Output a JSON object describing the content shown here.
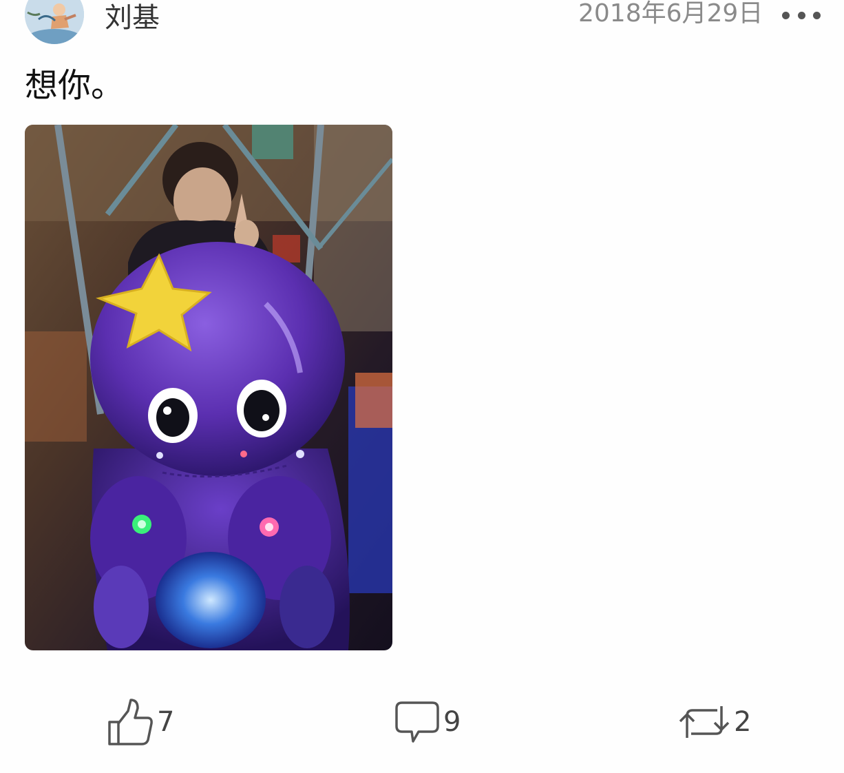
{
  "author": {
    "name": "刘基",
    "avatar_icon": "cartoon-avatar"
  },
  "post": {
    "date": "2018年6月29日",
    "text": "想你。",
    "image_description_icon": "photo"
  },
  "actions": {
    "likes": "7",
    "comments": "9",
    "reposts": "2"
  },
  "colors": {
    "octopus": "#5b2fb0",
    "star": "#f2d33a",
    "icon": "#555555",
    "muted_text": "#8a8a8a"
  }
}
